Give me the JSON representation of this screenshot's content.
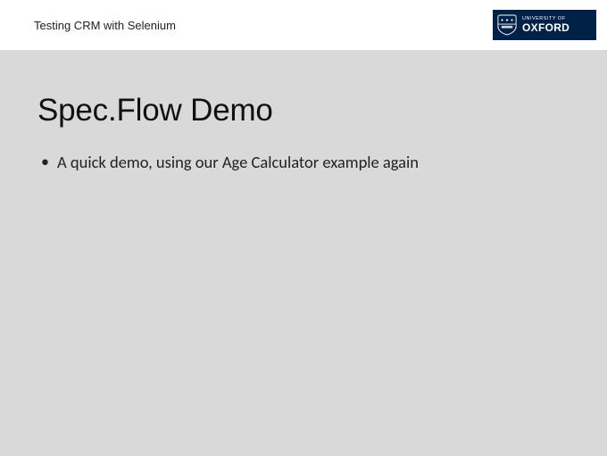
{
  "header": {
    "title": "Testing CRM with Selenium",
    "logo": {
      "subtext": "UNIVERSITY OF",
      "maintext": "OXFORD"
    }
  },
  "content": {
    "title": "Spec.Flow Demo",
    "bullets": [
      "A quick demo, using our Age Calculator example again"
    ]
  }
}
